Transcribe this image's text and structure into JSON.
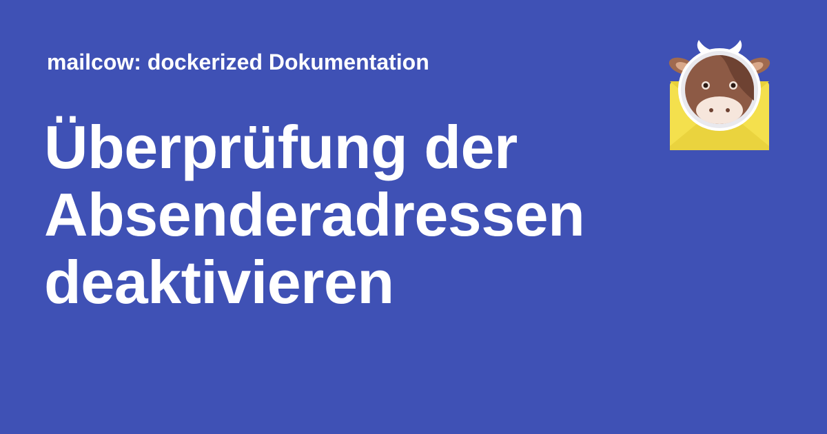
{
  "header": {
    "site_name": "mailcow: dockerized Dokumentation"
  },
  "main": {
    "title_lines": [
      "Überprüfung der",
      "Absenderadressen",
      "deaktivieren"
    ]
  },
  "logo": {
    "icon": "mailcow-cow-envelope-icon"
  },
  "colors": {
    "background": "#3f51b5",
    "text": "#ffffff",
    "envelope": "#f4e04d",
    "cow_brown": "#8d5a45"
  }
}
